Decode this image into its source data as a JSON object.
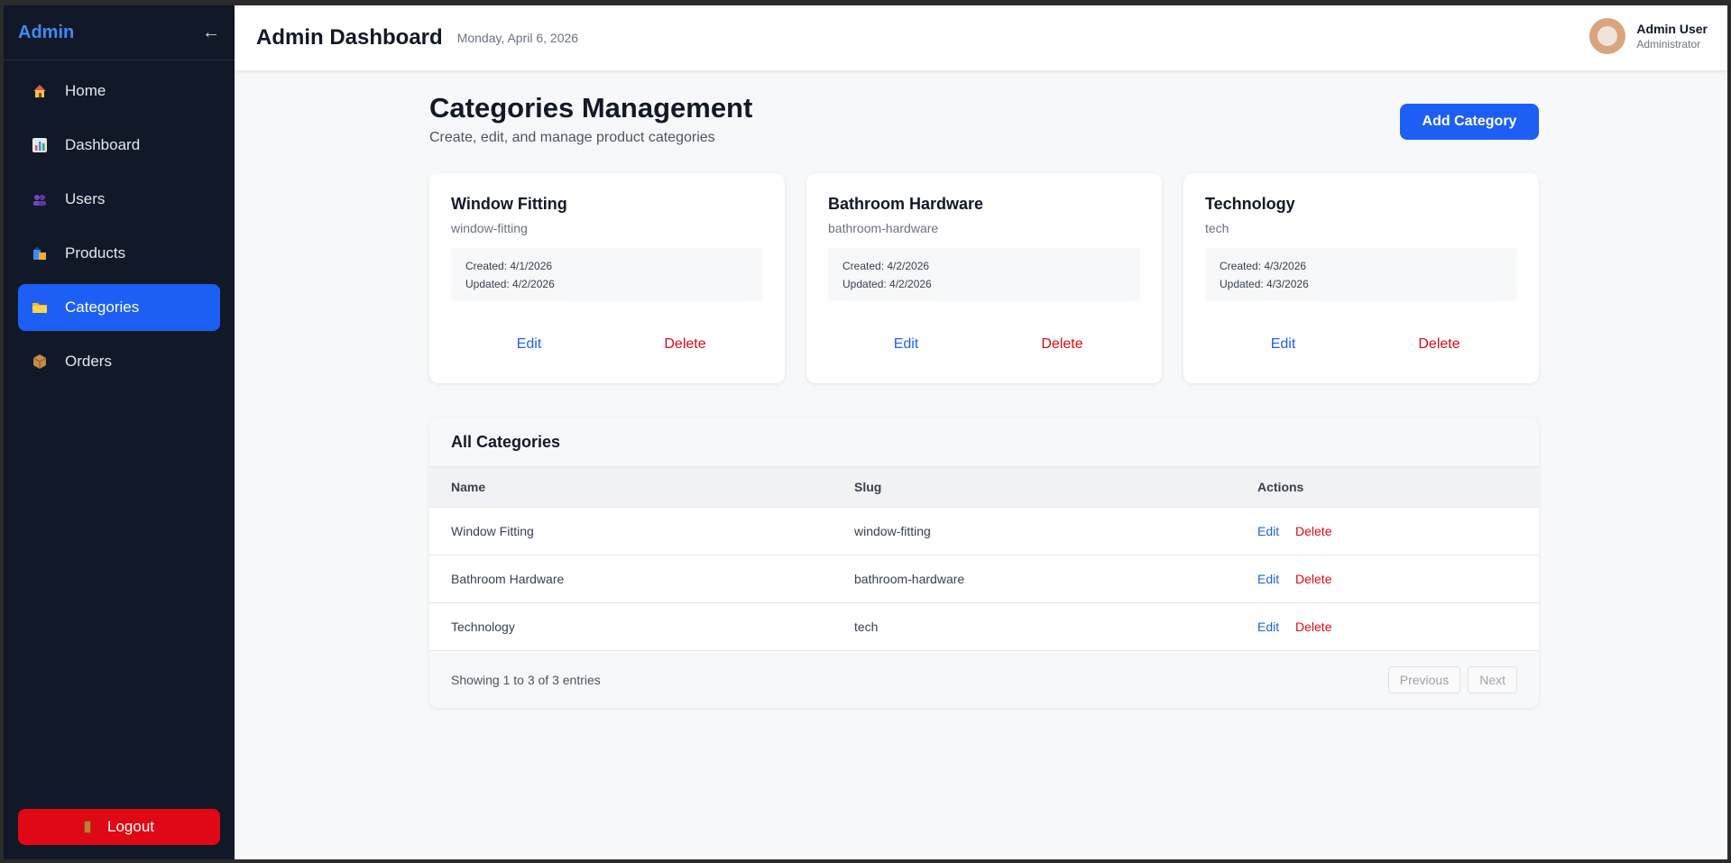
{
  "sidebar": {
    "brand": "Admin",
    "collapse_icon": "←",
    "items": [
      {
        "label": "Home",
        "icon": "home-icon",
        "active": false
      },
      {
        "label": "Dashboard",
        "icon": "chart-icon",
        "active": false
      },
      {
        "label": "Users",
        "icon": "users-icon",
        "active": false
      },
      {
        "label": "Products",
        "icon": "shopping-bags-icon",
        "active": false
      },
      {
        "label": "Categories",
        "icon": "folder-icon",
        "active": true
      },
      {
        "label": "Orders",
        "icon": "package-icon",
        "active": false
      }
    ],
    "logout_label": "Logout"
  },
  "header": {
    "title": "Admin Dashboard",
    "date": "Monday, April 6, 2026",
    "user_name": "Admin User",
    "user_role": "Administrator"
  },
  "page": {
    "title": "Categories Management",
    "subtitle": "Create, edit, and manage product categories",
    "add_button": "Add Category"
  },
  "cards": [
    {
      "name": "Window Fitting",
      "slug": "window-fitting",
      "created": "Created: 4/1/2026",
      "updated": "Updated: 4/2/2026",
      "edit": "Edit",
      "delete": "Delete"
    },
    {
      "name": "Bathroom Hardware",
      "slug": "bathroom-hardware",
      "created": "Created: 4/2/2026",
      "updated": "Updated: 4/2/2026",
      "edit": "Edit",
      "delete": "Delete"
    },
    {
      "name": "Technology",
      "slug": "tech",
      "created": "Created: 4/3/2026",
      "updated": "Updated: 4/3/2026",
      "edit": "Edit",
      "delete": "Delete"
    }
  ],
  "table": {
    "title": "All Categories",
    "columns": [
      "Name",
      "Slug",
      "Actions"
    ],
    "rows": [
      {
        "name": "Window Fitting",
        "slug": "window-fitting",
        "edit": "Edit",
        "delete": "Delete"
      },
      {
        "name": "Bathroom Hardware",
        "slug": "bathroom-hardware",
        "edit": "Edit",
        "delete": "Delete"
      },
      {
        "name": "Technology",
        "slug": "tech",
        "edit": "Edit",
        "delete": "Delete"
      }
    ],
    "footer_text": "Showing 1 to 3 of 3 entries",
    "prev_label": "Previous",
    "next_label": "Next"
  },
  "colors": {
    "sidebar_bg": "#111827",
    "accent": "#1d5ff5",
    "danger": "#e00814"
  }
}
